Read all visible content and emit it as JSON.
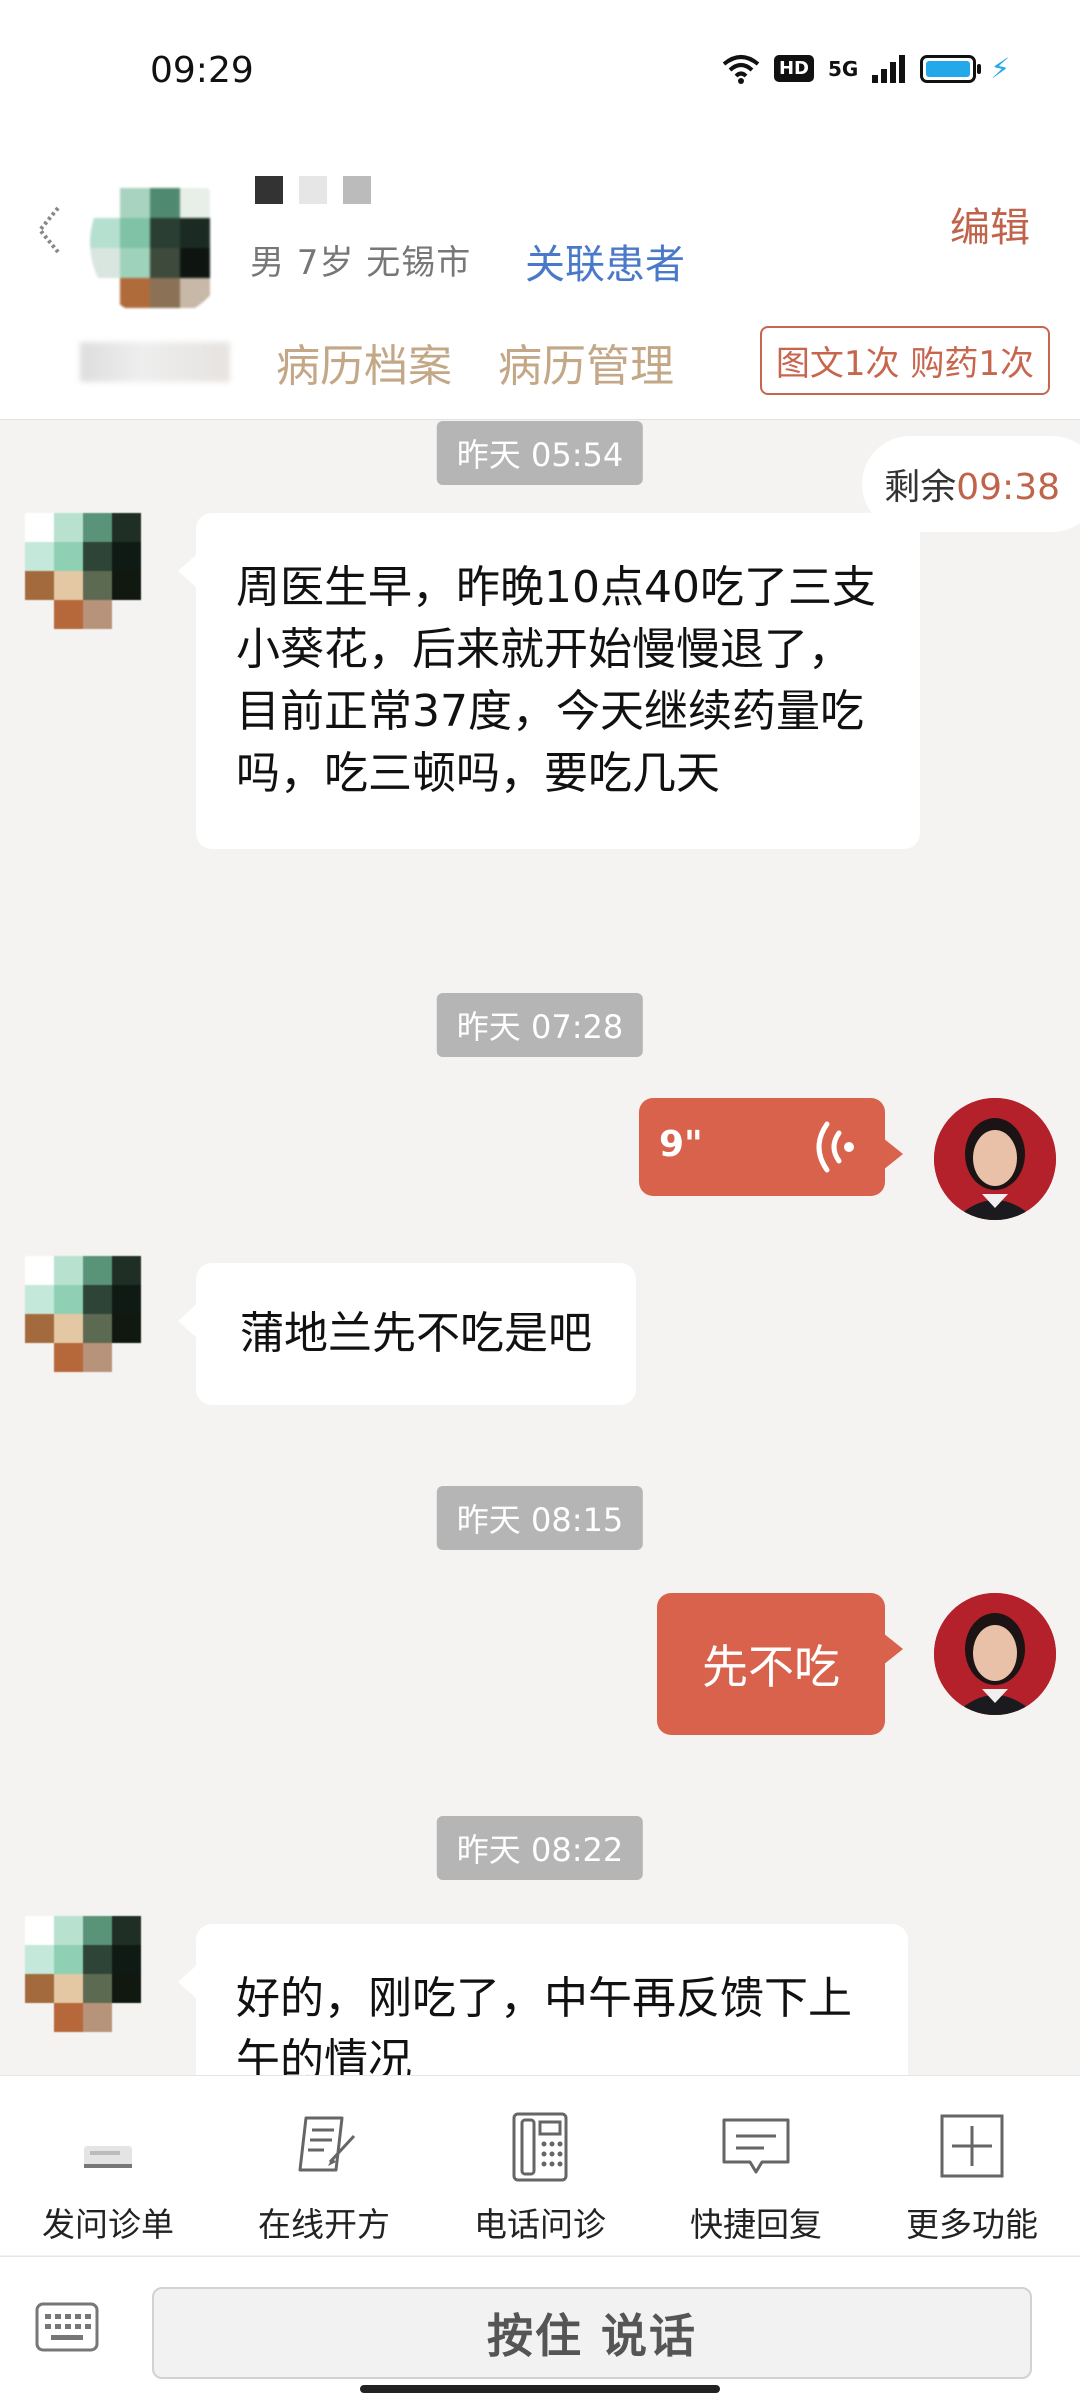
{
  "status_bar": {
    "time": "09:29",
    "hd": "HD",
    "net": "5G"
  },
  "header": {
    "patient_info": "男 7岁  无锡市",
    "link_patient": "关联患者",
    "edit": "编辑",
    "tabs": [
      "病历档案",
      "病历管理"
    ],
    "quota": "图文1次 购药1次"
  },
  "chat": {
    "remaining_label": "剩余",
    "remaining_time": "09:38",
    "messages": [
      {
        "timestamp": "昨天 05:54",
        "side": "left",
        "text": "周医生早，昨晚10点40吃了三支小葵花，后来就开始慢慢退了，目前正常37度，今天继续药量吃吗，吃三顿吗，要吃几天"
      },
      {
        "timestamp": "昨天 07:28",
        "side": "right",
        "type": "voice",
        "duration": "9\""
      },
      {
        "side": "left",
        "text": "蒲地兰先不吃是吧"
      },
      {
        "timestamp": "昨天 08:15",
        "side": "right",
        "text": "先不吃"
      },
      {
        "timestamp": "昨天 08:22",
        "side": "left",
        "text": "好的，刚吃了，中午再反馈下上午的情况"
      }
    ]
  },
  "toolbar": {
    "items": [
      {
        "label": "发问诊单",
        "icon": "form-icon"
      },
      {
        "label": "在线开方",
        "icon": "prescription-icon"
      },
      {
        "label": "电话问诊",
        "icon": "phone-icon"
      },
      {
        "label": "快捷回复",
        "icon": "chat-icon"
      },
      {
        "label": "更多功能",
        "icon": "plus-box-icon"
      }
    ]
  },
  "input": {
    "hold_to_talk": "按住 说话"
  },
  "colors": {
    "accent": "#d9624c",
    "link": "#4a79c9",
    "tab": "#c3a787"
  }
}
